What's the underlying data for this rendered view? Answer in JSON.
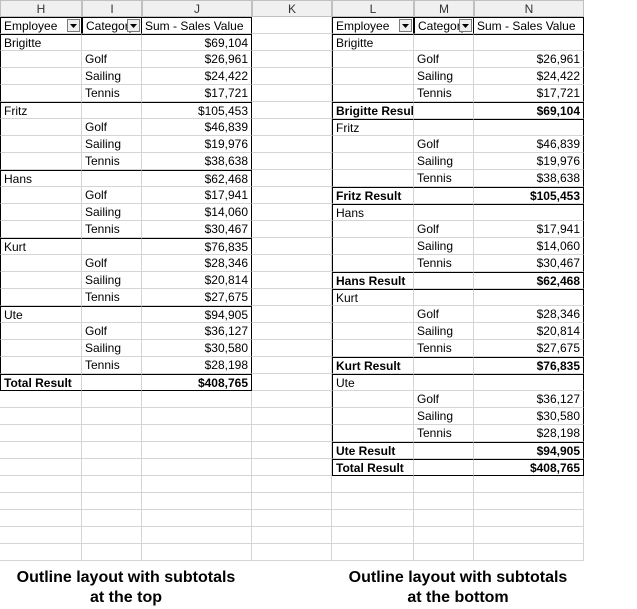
{
  "cols": [
    "H",
    "I",
    "J",
    "K",
    "L",
    "M",
    "N"
  ],
  "hdr": {
    "employee": "Employee",
    "category": "Category",
    "sum": "Sum - Sales Value"
  },
  "cat": {
    "golf": "Golf",
    "sailing": "Sailing",
    "tennis": "Tennis"
  },
  "total_label": "Total Result",
  "result_suffix": " Result",
  "employees": [
    {
      "name": "Brigitte",
      "golf": "$26,961",
      "sailing": "$24,422",
      "tennis": "$17,721",
      "sub": "$69,104"
    },
    {
      "name": "Fritz",
      "golf": "$46,839",
      "sailing": "$19,976",
      "tennis": "$38,638",
      "sub": "$105,453"
    },
    {
      "name": "Hans",
      "golf": "$17,941",
      "sailing": "$14,060",
      "tennis": "$30,467",
      "sub": "$62,468"
    },
    {
      "name": "Kurt",
      "golf": "$28,346",
      "sailing": "$20,814",
      "tennis": "$27,675",
      "sub": "$76,835"
    },
    {
      "name": "Ute",
      "golf": "$36,127",
      "sailing": "$30,580",
      "tennis": "$28,198",
      "sub": "$94,905"
    }
  ],
  "total": "$408,765",
  "captions": {
    "left_l1": "Outline layout with subtotals",
    "left_l2": "at the top",
    "right_l1": "Outline layout with subtotals",
    "right_l2": "at the bottom"
  },
  "icons": {
    "dropdown": "dropdown-icon"
  }
}
